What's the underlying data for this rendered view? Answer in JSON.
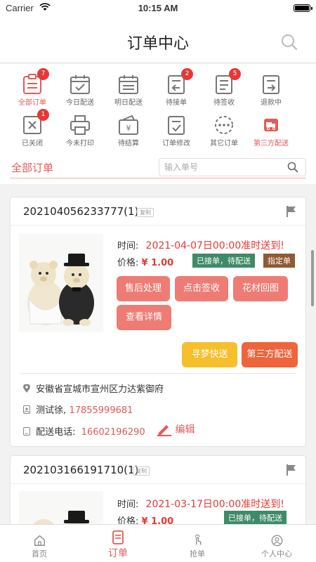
{
  "status": {
    "carrier": "Carrier",
    "time": "10:15 AM"
  },
  "nav": {
    "title": "订单中心",
    "search_icon": "search-icon"
  },
  "categories": [
    {
      "label": "全部订单",
      "badge": "7"
    },
    {
      "label": "今日配送",
      "badge": ""
    },
    {
      "label": "明日配送",
      "badge": ""
    },
    {
      "label": "待接单",
      "badge": "2"
    },
    {
      "label": "待签收",
      "badge": "5"
    },
    {
      "label": "退款中",
      "badge": ""
    },
    {
      "label": "已关闭",
      "badge": "1"
    },
    {
      "label": "今未打印",
      "badge": ""
    },
    {
      "label": "待结算",
      "badge": ""
    },
    {
      "label": "订单修改",
      "badge": ""
    },
    {
      "label": "其它订单",
      "badge": ""
    },
    {
      "label": "第三方配送",
      "badge": ""
    }
  ],
  "filter": {
    "all_label": "全部订单",
    "search_placeholder": "输入单号"
  },
  "orders": [
    {
      "id": "202104056233777(1)",
      "copy_label": "复制",
      "time_label": "时间:",
      "time_value": "2021-04-07日00:00准时送到!",
      "price_label": "价格:",
      "price_value": "¥ 1.00",
      "status_tag": "已接单，待配送",
      "extra_tag": "指定单",
      "buttons": [
        "售后处理",
        "点击签收",
        "花材回图",
        "查看详情"
      ],
      "delivery_buttons": [
        "寻梦快送",
        "第三方配送"
      ],
      "address": "安徽省宣城市宣州区力达紫御府",
      "contact": "测试徐,",
      "contact_phone": "17855999681",
      "delivery_phone_label": "配送电话:",
      "delivery_phone": "16602196290",
      "edit_label": "编辑"
    },
    {
      "id": "202103166191710(1)",
      "copy_label": "复制",
      "time_label": "时间:",
      "time_value": "2021-03-17日00:00准时送到!",
      "price_label": "价格:",
      "price_value": "¥ 1.00",
      "status_tag": "已接单，待配送"
    }
  ],
  "tabbar": [
    {
      "label": "首页"
    },
    {
      "label": "订单"
    },
    {
      "label": "抢单"
    },
    {
      "label": "个人中心"
    }
  ],
  "colors": {
    "accent": "#e55a56",
    "green_tag": "#3f8a68",
    "brown_tag": "#8f5a35",
    "yellow": "#f5c02c",
    "orange": "#f0643c"
  }
}
